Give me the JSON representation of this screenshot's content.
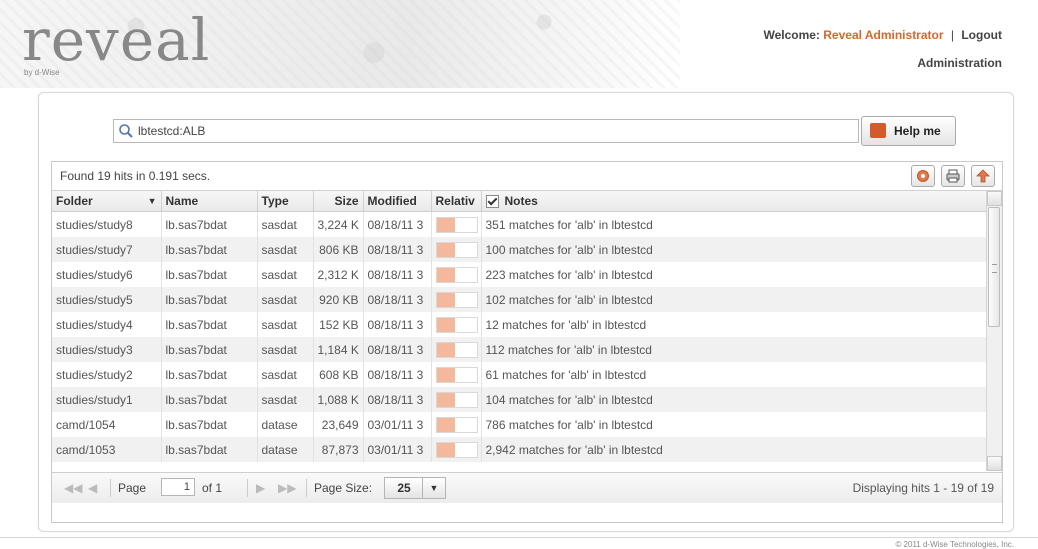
{
  "header": {
    "logo_text": "reveal",
    "logo_sub": "by d-Wise",
    "welcome_label": "Welcome:",
    "user_name": "Reveal Administrator",
    "separator": "|",
    "logout_label": "Logout",
    "admin_label": "Administration"
  },
  "search": {
    "value": "lbtestcd:ALB",
    "help_label": "Help me"
  },
  "results": {
    "status": "Found 19 hits in 0.191 secs.",
    "columns": [
      "Folder",
      "Name",
      "Type",
      "Size",
      "Modified",
      "Relativ",
      "Notes"
    ],
    "rows": [
      {
        "folder": "studies/study8",
        "name": "lb.sas7bdat",
        "type": "sasdat",
        "size": "3,224 K",
        "modified": "08/18/11 3",
        "relevance": 0.45,
        "notes": "351 matches for 'alb' in lbtestcd"
      },
      {
        "folder": "studies/study7",
        "name": "lb.sas7bdat",
        "type": "sasdat",
        "size": "806 KB",
        "modified": "08/18/11 3",
        "relevance": 0.45,
        "notes": "100 matches for 'alb' in lbtestcd"
      },
      {
        "folder": "studies/study6",
        "name": "lb.sas7bdat",
        "type": "sasdat",
        "size": "2,312 K",
        "modified": "08/18/11 3",
        "relevance": 0.45,
        "notes": "223 matches for 'alb' in lbtestcd"
      },
      {
        "folder": "studies/study5",
        "name": "lb.sas7bdat",
        "type": "sasdat",
        "size": "920 KB",
        "modified": "08/18/11 3",
        "relevance": 0.45,
        "notes": "102 matches for 'alb' in lbtestcd"
      },
      {
        "folder": "studies/study4",
        "name": "lb.sas7bdat",
        "type": "sasdat",
        "size": "152 KB",
        "modified": "08/18/11 3",
        "relevance": 0.45,
        "notes": "12 matches for 'alb' in lbtestcd"
      },
      {
        "folder": "studies/study3",
        "name": "lb.sas7bdat",
        "type": "sasdat",
        "size": "1,184 K",
        "modified": "08/18/11 3",
        "relevance": 0.45,
        "notes": "112 matches for 'alb' in lbtestcd"
      },
      {
        "folder": "studies/study2",
        "name": "lb.sas7bdat",
        "type": "sasdat",
        "size": "608 KB",
        "modified": "08/18/11 3",
        "relevance": 0.45,
        "notes": "61 matches for 'alb' in lbtestcd"
      },
      {
        "folder": "studies/study1",
        "name": "lb.sas7bdat",
        "type": "sasdat",
        "size": "1,088 K",
        "modified": "08/18/11 3",
        "relevance": 0.45,
        "notes": "104 matches for 'alb' in lbtestcd"
      },
      {
        "folder": "camd/1054",
        "name": "lb.sas7bdat",
        "type": "datase",
        "size": "23,649",
        "modified": "03/01/11 3",
        "relevance": 0.45,
        "notes": "786 matches for 'alb' in lbtestcd"
      },
      {
        "folder": "camd/1053",
        "name": "lb.sas7bdat",
        "type": "datase",
        "size": "87,873",
        "modified": "03/01/11 3",
        "relevance": 0.45,
        "notes": "2,942 matches for 'alb' in lbtestcd"
      }
    ]
  },
  "pager": {
    "page_label": "Page",
    "page_value": "1",
    "of_label": "of 1",
    "page_size_label": "Page Size:",
    "page_size_value": "25",
    "displaying": "Displaying hits 1 - 19 of 19"
  },
  "footer": {
    "copyright": "© 2011 d-Wise Technologies, Inc."
  },
  "colors": {
    "accent": "#d9662a",
    "relevance_fill": "#f4b89d"
  },
  "icons": [
    "search-icon",
    "help-icon",
    "settings-icon",
    "print-icon",
    "export-icon",
    "first-page-icon",
    "prev-page-icon",
    "next-page-icon",
    "last-page-icon"
  ]
}
